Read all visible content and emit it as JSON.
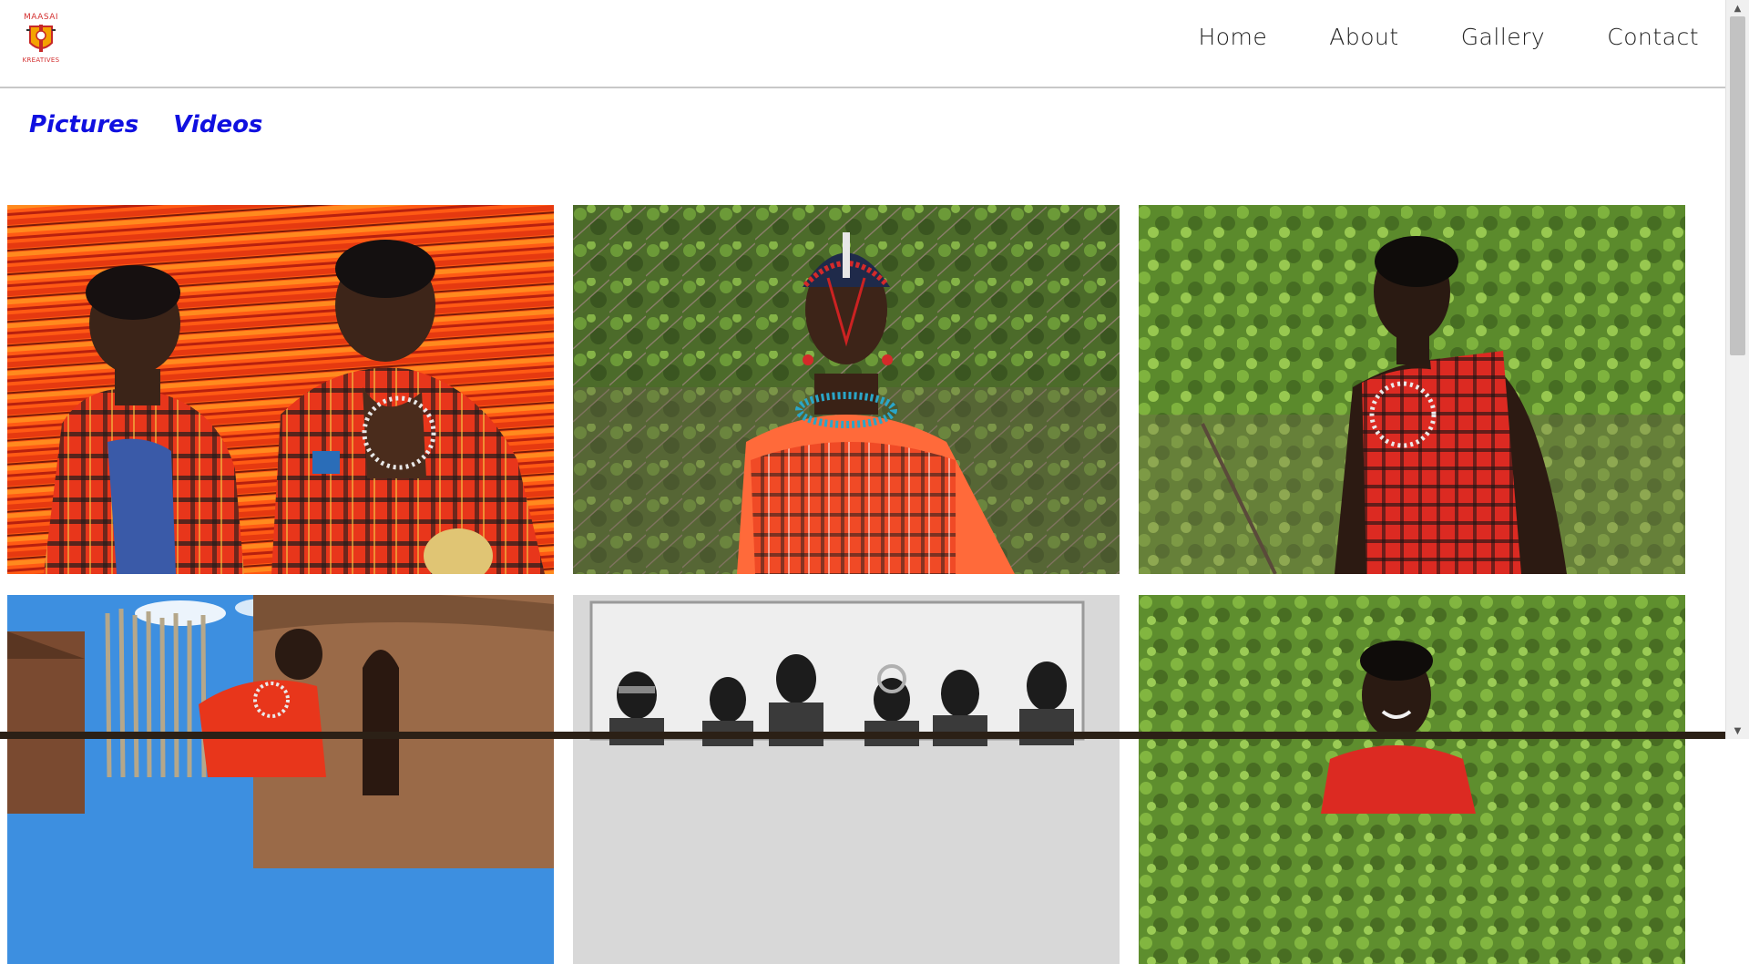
{
  "brand": {
    "logo_top": "MAASAI",
    "logo_bottom": "KREATIVES",
    "logo_color": "#d32f2f"
  },
  "nav": {
    "items": [
      {
        "label": "Home"
      },
      {
        "label": "About"
      },
      {
        "label": "Gallery"
      },
      {
        "label": "Contact"
      }
    ]
  },
  "subnav": {
    "items": [
      {
        "label": "Pictures"
      },
      {
        "label": "Videos"
      }
    ],
    "color": "#1010e0"
  },
  "gallery": {
    "photos": [
      {
        "name": "photo-two-men-red-shukas"
      },
      {
        "name": "photo-woman-beaded-headdress"
      },
      {
        "name": "photo-man-checkered-shuka"
      },
      {
        "name": "photo-village-hut"
      },
      {
        "name": "photo-group-black-white"
      },
      {
        "name": "photo-smiling-man-bushes"
      }
    ]
  },
  "scrollbar": {
    "up_icon": "scroll-up-arrow-icon",
    "down_icon": "scroll-down-arrow-icon"
  }
}
